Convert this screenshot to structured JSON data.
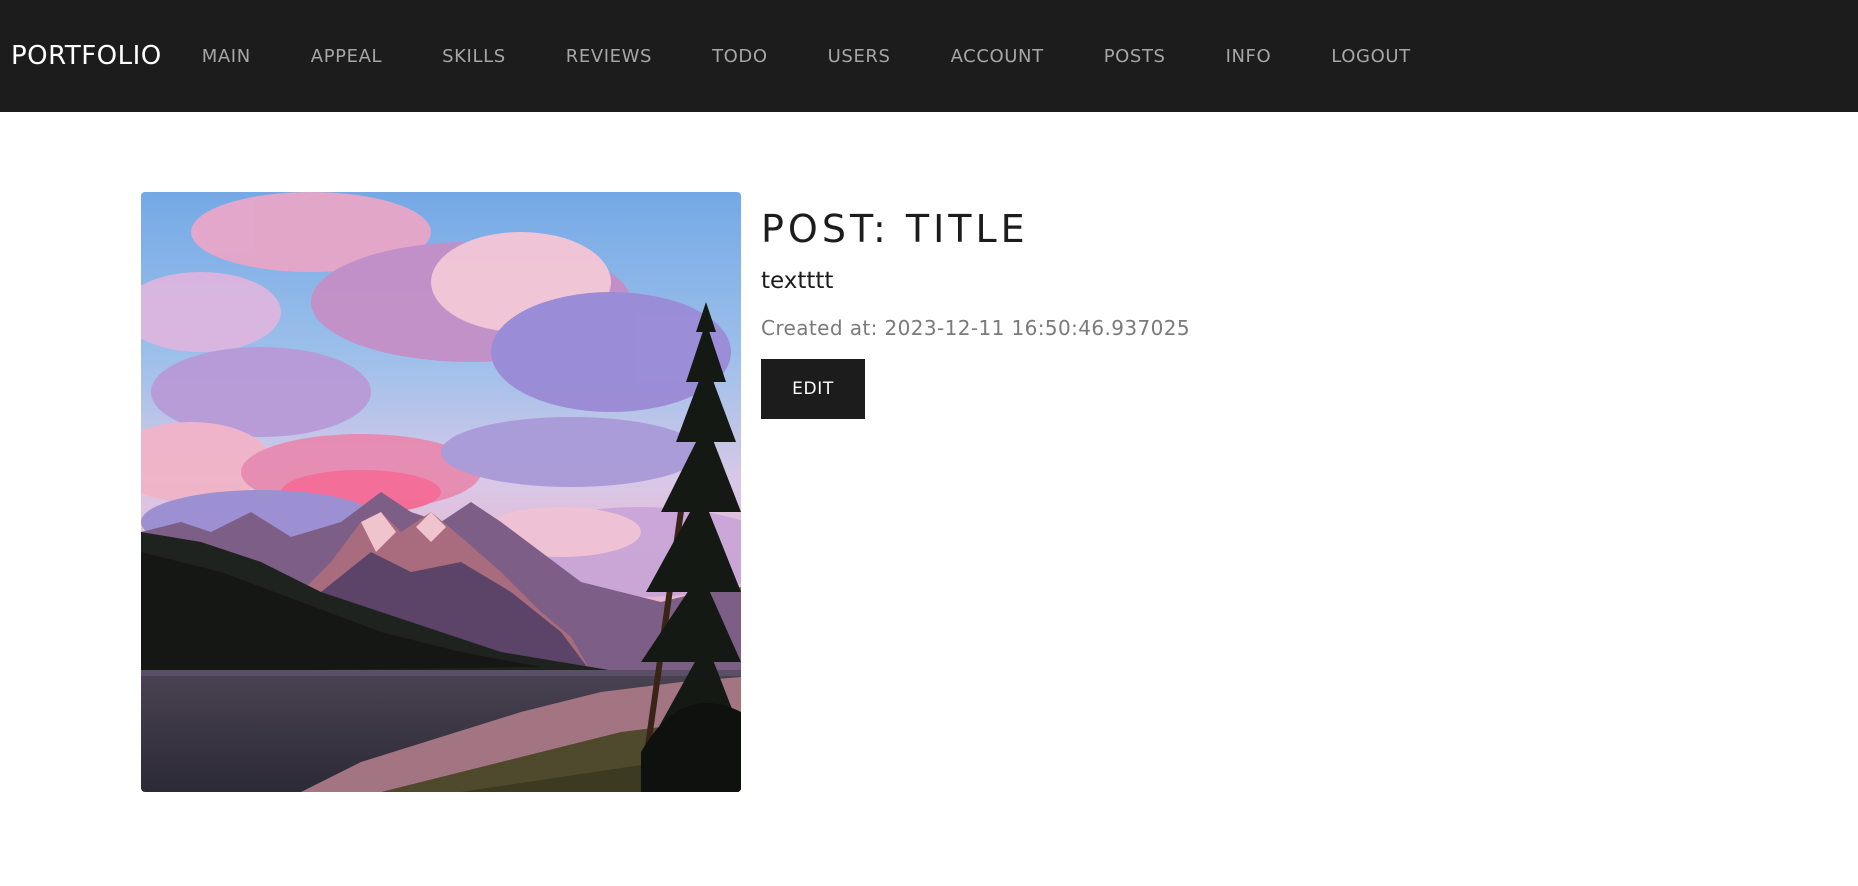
{
  "navbar": {
    "brand": "PORTFOLIO",
    "items": [
      {
        "label": "MAIN"
      },
      {
        "label": "APPEAL"
      },
      {
        "label": "SKILLS"
      },
      {
        "label": "REVIEWS"
      },
      {
        "label": "TODO"
      },
      {
        "label": "USERS"
      },
      {
        "label": "ACCOUNT"
      },
      {
        "label": "POSTS"
      },
      {
        "label": "INFO"
      },
      {
        "label": "LOGOUT"
      }
    ]
  },
  "post": {
    "title": "POST: TITLE",
    "text": "textttt",
    "created_at": "Created at: 2023-12-11 16:50:46.937025",
    "edit_label": "EDIT"
  },
  "colors": {
    "navbar_bg": "#1c1c1c",
    "nav_link": "#a6a6a6",
    "brand": "#ffffff",
    "button_bg": "#1c1c1c",
    "meta_text": "#7a7a7a"
  }
}
